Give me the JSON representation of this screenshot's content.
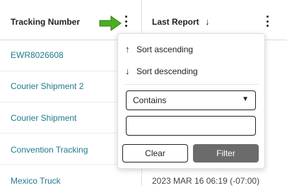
{
  "grid": {
    "columns": [
      {
        "header": "Tracking Number"
      },
      {
        "header": "Last Report",
        "sort_indicator": "↓"
      }
    ],
    "rows": [
      {
        "tracking_number": "EWR8026608"
      },
      {
        "tracking_number": "Courier Shipment 2"
      },
      {
        "tracking_number": "Courier Shipment"
      },
      {
        "tracking_number": "Convention Tracking"
      },
      {
        "tracking_number": "Mexico Truck",
        "last_report": "2023 MAR 16 06:19 (-07:00)"
      }
    ]
  },
  "column_menu": {
    "sort_ascending": {
      "glyph": "↑",
      "label": "Sort ascending"
    },
    "sort_descending": {
      "glyph": "↓",
      "label": "Sort descending"
    },
    "operator": {
      "value": "Contains",
      "caret": "▼"
    },
    "filter_value": "",
    "clear_label": "Clear",
    "filter_label": "Filter"
  },
  "icons": [
    "green-arrow-icon",
    "kebab-menu-icon",
    "arrow-up-icon",
    "arrow-down-icon"
  ],
  "colors": {
    "link_text": "#1f7a8c",
    "annotation_arrow": "#4caf1f",
    "filter_button_bg": "#6b6b6b"
  }
}
